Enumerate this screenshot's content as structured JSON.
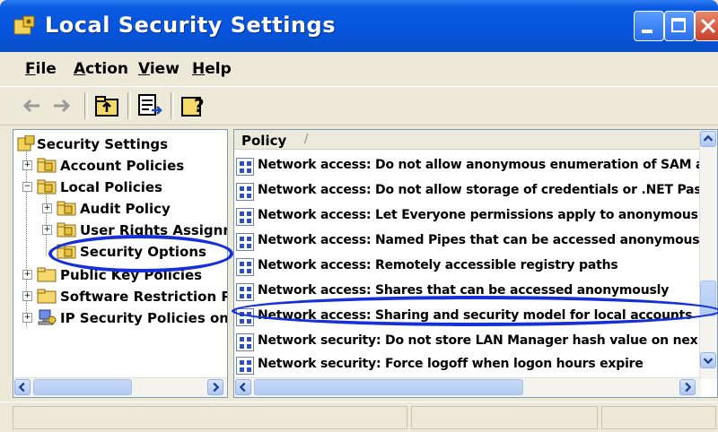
{
  "window": {
    "title": "Local Security Settings"
  },
  "menu": [
    {
      "label": "File"
    },
    {
      "label": "Action"
    },
    {
      "label": "View"
    },
    {
      "label": "Help"
    }
  ],
  "toolbar": {
    "buttons": [
      "back-arrow-icon",
      "forward-arrow-icon",
      "up-folder-icon",
      "export-list-icon",
      "help-icon"
    ]
  },
  "tree": {
    "root": "Security Settings",
    "items": [
      {
        "label": "Account Policies",
        "expander": "+"
      },
      {
        "label": "Local Policies",
        "expander": "−"
      },
      {
        "label": "Audit Policy",
        "expander": "+"
      },
      {
        "label": "User Rights Assignment",
        "expander": "+"
      },
      {
        "label": "Security Options",
        "expander": ""
      },
      {
        "label": "Public Key Policies",
        "expander": "+"
      },
      {
        "label": "Software Restriction P",
        "expander": "+"
      },
      {
        "label": "IP Security Policies on",
        "expander": "+"
      }
    ]
  },
  "list": {
    "column_header": "Policy",
    "sort_indicator": "/",
    "rows": [
      "Network access: Do not allow anonymous enumeration of SAM a",
      "Network access: Do not allow storage of credentials or .NET Pas",
      "Network access: Let Everyone permissions apply to anonymous",
      "Network access: Named Pipes that can be accessed anonymous",
      "Network access: Remotely accessible registry paths",
      "Network access: Shares that can be accessed anonymously",
      "Network access: Sharing and security model for local accounts",
      "Network security: Do not store LAN Manager hash value on nex",
      "Network security: Force logoff when logon hours expire"
    ]
  },
  "colors": {
    "titlebar": "#0654dc",
    "annotation": "#1530d8",
    "chrome": "#ece9d8"
  }
}
